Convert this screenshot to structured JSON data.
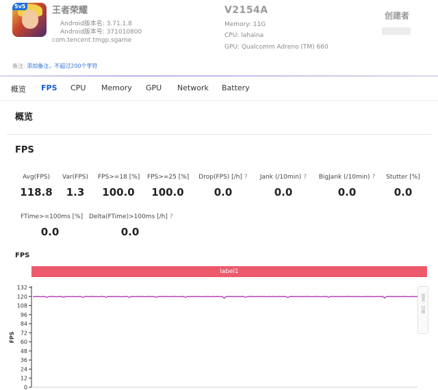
{
  "app": {
    "name": "王者荣耀",
    "icon_badge": "5v5",
    "version_name": "Android版本名: 3.71.1.8",
    "version_code": "Android版本号: 371010800",
    "package": "com.tencent.tmgp.sgame"
  },
  "device": {
    "model": "V2154A",
    "memory": "Memory: 11G",
    "cpu": "CPU: lahaina",
    "gpu": "GPU: Qualcomm Adreno (TM) 660"
  },
  "creator": {
    "label": "创建者"
  },
  "note": {
    "label": "备注:",
    "link": "添加备注，不超过200个字符"
  },
  "tabs": [
    "概览",
    "FPS",
    "CPU",
    "Memory",
    "GPU",
    "Network",
    "Battery"
  ],
  "active_tab": "FPS",
  "overview_title": "概览",
  "fps_section_title": "FPS",
  "stats_row1": [
    {
      "label": "Avg(FPS)",
      "value": "118.8"
    },
    {
      "label": "Var(FPS)",
      "value": "1.3"
    },
    {
      "label": "FPS>=18 [%]",
      "value": "100.0"
    },
    {
      "label": "FPS>=25 [%]",
      "value": "100.0"
    },
    {
      "label": "Drop(FPS) [/h]",
      "value": "0.0",
      "help": "?"
    },
    {
      "label": "Jank (/10min)",
      "value": "0.0",
      "help": "?"
    },
    {
      "label": "BigJank (/10min)",
      "value": "0.0",
      "help": "?"
    },
    {
      "label": "Stutter [%]",
      "value": "0.0"
    }
  ],
  "stats_row2": [
    {
      "label": "FTime>=100ms [%]",
      "value": "0.0"
    },
    {
      "label": "Delta(FTime)>100ms [/h]",
      "value": "0.0",
      "help": "?"
    }
  ],
  "chart_title": "FPS",
  "label_bar": "label1",
  "side_widget": "图表 · 切换",
  "colors": {
    "accent": "#1a5bd1",
    "label_bar": "#ec5a6c",
    "series": "#b43cb4"
  },
  "chart_data": {
    "type": "line",
    "ylabel": "FPS",
    "ylim": [
      0,
      132
    ],
    "yticks": [
      0,
      12,
      24,
      36,
      48,
      60,
      72,
      84,
      96,
      108,
      120,
      132
    ],
    "grid": false,
    "series": [
      {
        "values": [
          119.5,
          120,
          119.8,
          120,
          119.6,
          119.9,
          120,
          118.8,
          119.7,
          120,
          119.9,
          120,
          119.5,
          120,
          119.8,
          119.9,
          118.9,
          120,
          119.7,
          120,
          119.8,
          120,
          119.6,
          119.9,
          120,
          119.8,
          118.7,
          119.9,
          120,
          119.7,
          120,
          119.9,
          119.8,
          120,
          119.5,
          120,
          119.9,
          119.8,
          118.9,
          120,
          119.8,
          120,
          119.7,
          119.9,
          120,
          119.8,
          119.6,
          120,
          119.9,
          120,
          118.8,
          119.9,
          120,
          119.7,
          120,
          119.9,
          119.8,
          120,
          119.6,
          120,
          119.9,
          119.8,
          120,
          119.7,
          118.9,
          120,
          119.9,
          120,
          119.8,
          119.9,
          120,
          119.7,
          120,
          119.9,
          120,
          119.6,
          120,
          119.8,
          119.9,
          118.8,
          120,
          119.7,
          120,
          119.9,
          119.8,
          120,
          119.9,
          119.7,
          120,
          119.8,
          120,
          119.9,
          119.6,
          120,
          119.8,
          120,
          119.9,
          119.7,
          120,
          117.6,
          119.8,
          120,
          119.9,
          120,
          119.7,
          119.9,
          120,
          119.8,
          119.9,
          120,
          118.9,
          119.8,
          120,
          119.9,
          120,
          119.7,
          119.9,
          120,
          119.8,
          120,
          119.9,
          119.6,
          120,
          119.8,
          120,
          119.9,
          119.7,
          120,
          119.8,
          119.9,
          120,
          119.8,
          118.7,
          120,
          119.9,
          119.8,
          120,
          119.7,
          120,
          119.9,
          119.8,
          120,
          119.9,
          120,
          119.7,
          119.8,
          120,
          119.9,
          120,
          119.6,
          120,
          119.8,
          120,
          118.9,
          120,
          119.9,
          119.8,
          120,
          119.7,
          119.9,
          120,
          119.8,
          120,
          119.9,
          120,
          119.7,
          120,
          119.8,
          119.9,
          120,
          119.6,
          120,
          119.8,
          120,
          119.9,
          119.8,
          120,
          119.7,
          119.9,
          120,
          119.8,
          120,
          117.9,
          119.8,
          120,
          119.9,
          120,
          119.7,
          120,
          119.9,
          119.8,
          120,
          119.9,
          120,
          119.7,
          119.8,
          120,
          119.9,
          119.8,
          120
        ]
      }
    ]
  }
}
